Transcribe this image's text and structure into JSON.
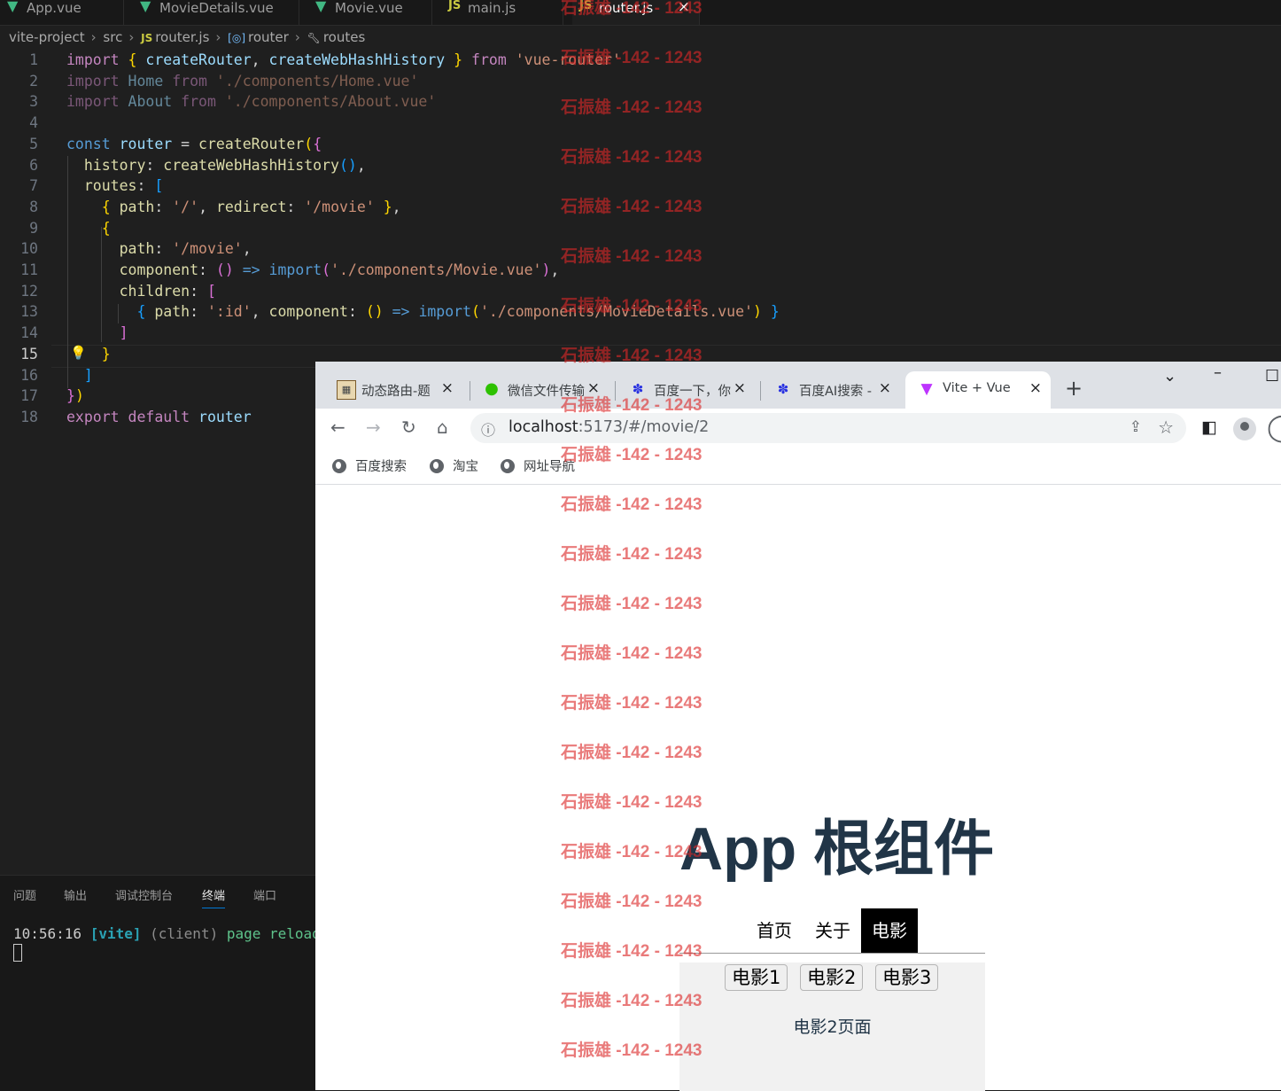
{
  "vscode": {
    "tabs": [
      {
        "label": "App.vue",
        "type": "vue"
      },
      {
        "label": "MovieDetails.vue",
        "type": "vue"
      },
      {
        "label": "Movie.vue",
        "type": "vue"
      },
      {
        "label": "main.js",
        "type": "js"
      },
      {
        "label": "router.js",
        "type": "js",
        "active": true
      }
    ],
    "js_badge": "JS",
    "close_glyph": "×",
    "breadcrumb": [
      "vite-project",
      "src",
      "router.js",
      "router",
      "routes"
    ],
    "current_line": 15,
    "code_lines": [
      "import { createRouter, createWebHashHistory } from 'vue-router'",
      "import Home from './components/Home.vue'",
      "import About from './components/About.vue'",
      "",
      "const router = createRouter({",
      "  history: createWebHashHistory(),",
      "  routes: [",
      "    { path: '/', redirect: '/movie' },",
      "    {",
      "      path: '/movie',",
      "      component: () => import('./components/Movie.vue'),",
      "      children: [",
      "        { path: ':id', component: () => import('./components/MovieDetails.vue') }",
      "      ]",
      "    }",
      "  ]",
      "})",
      "export default router"
    ],
    "panel_tabs": [
      "问题",
      "输出",
      "调试控制台",
      "终端",
      "端口"
    ],
    "active_panel_tab": "终端",
    "terminal": {
      "time": "10:56:16",
      "tag": "[vite]",
      "source": "(client)",
      "message": "page reload s"
    }
  },
  "browser": {
    "tabs": [
      {
        "label": "动态路由-题",
        "icon": "image-icon"
      },
      {
        "label": "微信文件传输",
        "icon": "wechat-icon"
      },
      {
        "label": "百度一下，你",
        "icon": "baidu-icon"
      },
      {
        "label": "百度AI搜索 -",
        "icon": "baidu-icon"
      },
      {
        "label": "Vite + Vue",
        "icon": "vite-icon",
        "active": true
      }
    ],
    "url_host": "localhost",
    "url_rest": ":5173/#/movie/2",
    "bookmarks": [
      "百度搜索",
      "淘宝",
      "网址导航"
    ]
  },
  "page": {
    "title": "App 根组件",
    "nav": [
      "首页",
      "关于",
      "电影"
    ],
    "active_nav": "电影",
    "movie_buttons": [
      "电影1",
      "电影2",
      "电影3"
    ],
    "detail_text": "电影2页面"
  },
  "watermark": "石振雄 -142 - 1243",
  "colors": {
    "accent": "#0078d4",
    "vue_green": "#41b883",
    "title": "#213547",
    "watermark": "#dc2828"
  }
}
